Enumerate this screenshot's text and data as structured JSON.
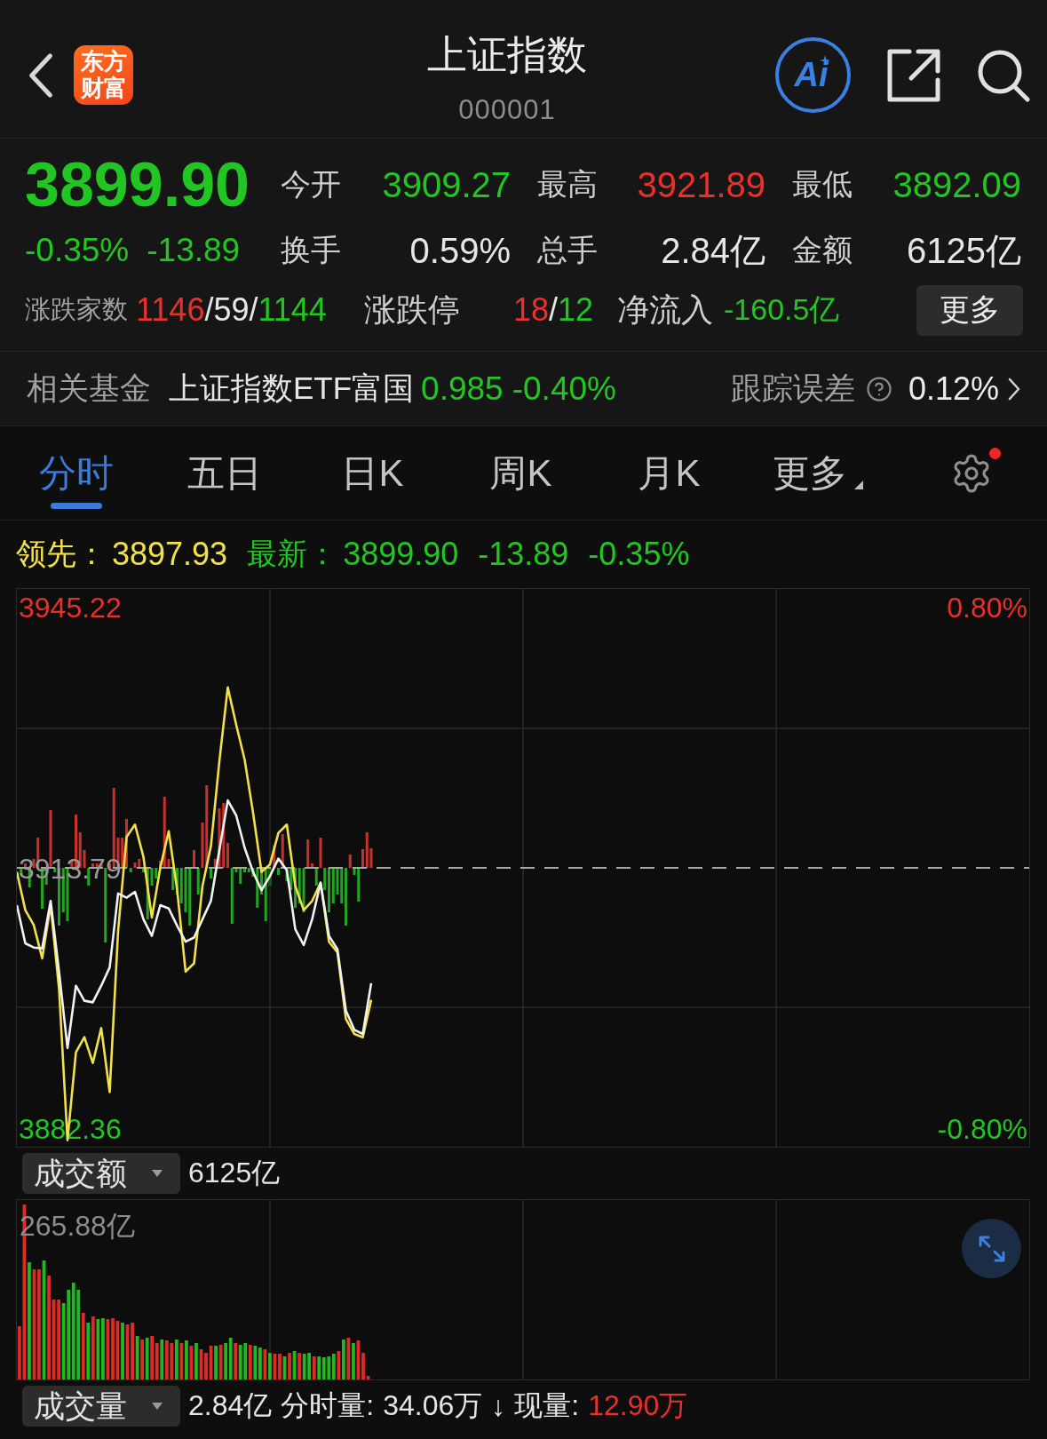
{
  "header": {
    "logo": "东方财富",
    "title": "上证指数",
    "code": "000001",
    "ai_label": "Ai"
  },
  "quote": {
    "price": {
      "text": "3899.90",
      "color": "#22c622"
    },
    "change_percent": {
      "text": "-0.35%",
      "color": "#22c622"
    },
    "change": {
      "text": "-13.89",
      "color": "#22c622"
    },
    "stats": [
      {
        "label": "今开",
        "value": "3909.27",
        "color": "#22c622"
      },
      {
        "label": "最高",
        "value": "3921.89",
        "color": "#e8302c"
      },
      {
        "label": "最低",
        "value": "3892.09",
        "color": "#22c622"
      },
      {
        "label": "换手",
        "value": "0.59%",
        "color": "#e6e6e6"
      },
      {
        "label": "总手",
        "value": "2.84亿",
        "color": "#e6e6e6"
      },
      {
        "label": "金额",
        "value": "6125亿",
        "color": "#e6e6e6"
      }
    ],
    "breadth": {
      "label": "涨跌家数",
      "parts": [
        {
          "text": "1146",
          "color": "#e8302c"
        },
        {
          "text": "/59/",
          "color": "#e6e6e6"
        },
        {
          "text": "1144",
          "color": "#22c622"
        }
      ]
    },
    "limit_moves": {
      "label": "涨跌停",
      "parts": [
        {
          "text": "18",
          "color": "#e8302c"
        },
        {
          "text": "/",
          "color": "#e6e6e6"
        },
        {
          "text": "12",
          "color": "#22c622"
        }
      ]
    },
    "net_inflow": {
      "label": "净流入",
      "value": "-160.5亿",
      "color": "#22c622"
    },
    "more_button": "更多"
  },
  "related_fund": {
    "label": "相关基金",
    "name": "上证指数ETF富国",
    "price": {
      "text": "0.985",
      "color": "#22c622"
    },
    "change": {
      "text": "-0.40%",
      "color": "#22c622"
    },
    "tracking_label": "跟踪误差",
    "tracking_value": "0.12%"
  },
  "chart_tabs": {
    "tabs": [
      {
        "label": "分时",
        "selected": true,
        "kind": "period"
      },
      {
        "label": "五日",
        "selected": false,
        "kind": "period"
      },
      {
        "label": "日K",
        "selected": false,
        "kind": "period"
      },
      {
        "label": "周K",
        "selected": false,
        "kind": "period"
      },
      {
        "label": "月K",
        "selected": false,
        "kind": "period"
      },
      {
        "label": "更多",
        "selected": false,
        "kind": "menu"
      }
    ],
    "settings_notification": true
  },
  "price_chart": {
    "legend": [
      {
        "values": [
          "3897.93"
        ],
        "color": "#f3e14a"
      },
      {
        "values": [
          "3899.90",
          "-13.89",
          "-0.35%"
        ],
        "color": "#22c622"
      }
    ],
    "right_axis": [
      {
        "label": "0.80%",
        "color": "#e8302c"
      },
      {
        "label": "-0.80%",
        "color": "#22c622"
      }
    ],
    "chart_data": {
      "type": "line",
      "categories": [
        null,
        null,
        null,
        null,
        null,
        null,
        null,
        null,
        null,
        null,
        null,
        null,
        null,
        null,
        null,
        null,
        null,
        null,
        null,
        null,
        null,
        null,
        null,
        null,
        null,
        null,
        null,
        null,
        null,
        null,
        null,
        null,
        null,
        null,
        null,
        null,
        null,
        null,
        null,
        null,
        null,
        null,
        null,
        null,
        null,
        null,
        null,
        null,
        null,
        null,
        null,
        null,
        null,
        null,
        null,
        null,
        null,
        null,
        null,
        null,
        null,
        null,
        null,
        null,
        null,
        null,
        null,
        null,
        null,
        null,
        null,
        null,
        null,
        null,
        null,
        null,
        null,
        null,
        null,
        null,
        null,
        null,
        null,
        null,
        null,
        null,
        null,
        null,
        null,
        null,
        null,
        null,
        null,
        null,
        null,
        null,
        null,
        null,
        null,
        null,
        null,
        null,
        null,
        null,
        null,
        null,
        null,
        null,
        null,
        null,
        null,
        null,
        null,
        null,
        null,
        null,
        null,
        null,
        null,
        null,
        null
      ],
      "ylim": [
        3880.22,
        3947.36
      ],
      "yticks": [
        {
          "value": 3945.22,
          "label": "3945.22"
        },
        {
          "value": 3913.79,
          "label": "3913.79"
        },
        {
          "value": 3882.36,
          "label": "3882.36"
        }
      ],
      "ref_lines": [
        {
          "axis": "y",
          "value": 3913.79
        }
      ],
      "series": [
        {
          "name": "领先：",
          "color": "#f3e14a",
          "values": [
            3913.3,
            3908.7,
            3906.9,
            3902.9,
            3909.3,
            3899.2,
            3881.0,
            3891.6,
            3893.4,
            3890.3,
            3894.5,
            3886.8,
            3906.2,
            3917.5,
            3919.0,
            3915.1,
            3907.8,
            3913.8,
            3918.2,
            3911.1,
            3901.3,
            3902.3,
            3911.6,
            3916.4,
            3926.6,
            3935.5,
            3931.0,
            3926.8,
            3920.4,
            3913.3,
            3914.2,
            3918.0,
            3919.0,
            3911.6,
            3908.7,
            3909.8,
            3912.0,
            3904.9,
            3903.6,
            3895.6,
            3893.8,
            3893.4,
            3897.9,
            null,
            null,
            null,
            null,
            null,
            null,
            null,
            null,
            null,
            null,
            null,
            null,
            null,
            null,
            null,
            null,
            null,
            null,
            null,
            null,
            null,
            null,
            null,
            null,
            null,
            null,
            null,
            null,
            null,
            null,
            null,
            null,
            null,
            null,
            null,
            null,
            null,
            null,
            null,
            null,
            null,
            null,
            null,
            null,
            null,
            null,
            null,
            null,
            null,
            null,
            null,
            null,
            null,
            null,
            null,
            null,
            null,
            null,
            null,
            null,
            null,
            null,
            null,
            null,
            null,
            null,
            null,
            null,
            null,
            null,
            null,
            null,
            null,
            null,
            null,
            null,
            null,
            null
          ]
        },
        {
          "name": "最新：",
          "color": "#f2f2f2",
          "values": [
            3909.3,
            3904.7,
            3904.2,
            3904.1,
            3909.8,
            3901.3,
            3892.1,
            3899.6,
            3897.8,
            3897.6,
            3899.6,
            3901.8,
            3910.7,
            3910.2,
            3910.9,
            3907.6,
            3905.6,
            3909.3,
            3908.9,
            3906.8,
            3904.9,
            3905.4,
            3907.6,
            3909.8,
            3915.9,
            3921.9,
            3920.1,
            3916.2,
            3913.3,
            3911.1,
            3912.8,
            3914.9,
            3913.5,
            3906.4,
            3904.5,
            3907.6,
            3912.0,
            3905.6,
            3904.0,
            3896.6,
            3894.3,
            3893.8,
            3899.9,
            null,
            null,
            null,
            null,
            null,
            null,
            null,
            null,
            null,
            null,
            null,
            null,
            null,
            null,
            null,
            null,
            null,
            null,
            null,
            null,
            null,
            null,
            null,
            null,
            null,
            null,
            null,
            null,
            null,
            null,
            null,
            null,
            null,
            null,
            null,
            null,
            null,
            null,
            null,
            null,
            null,
            null,
            null,
            null,
            null,
            null,
            null,
            null,
            null,
            null,
            null,
            null,
            null,
            null,
            null,
            null,
            null,
            null,
            null,
            null,
            null,
            null,
            null,
            null,
            null,
            null,
            null,
            null,
            null,
            null,
            null,
            null,
            null,
            null,
            null,
            null,
            null,
            null
          ]
        }
      ]
    }
  },
  "amount_panel": {
    "selector": "成交额",
    "total": "6125亿",
    "top_label": "265.88亿"
  },
  "volume_panel": {
    "selector": "成交量",
    "items": [
      {
        "text": "2.84亿",
        "color": "#e6e6e6"
      },
      {
        "text": "分时量:",
        "color": "#e6e6e6"
      },
      {
        "text": "34.06万",
        "color": "#e6e6e6"
      },
      {
        "text": "↓",
        "color": "#e6e6e6"
      },
      {
        "text": "现量:",
        "color": "#e6e6e6"
      },
      {
        "text": "12.90万",
        "color": "#e8302c"
      }
    ]
  }
}
